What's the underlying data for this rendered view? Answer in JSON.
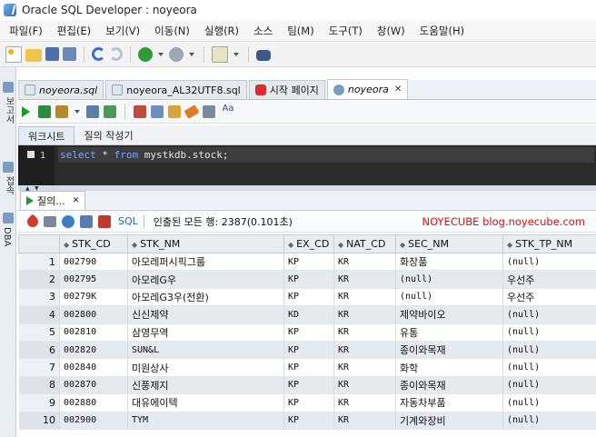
{
  "window": {
    "title": "Oracle SQL Developer : noyeora"
  },
  "menu": [
    "파일(F)",
    "편집(E)",
    "보기(V)",
    "이동(N)",
    "실행(R)",
    "소스",
    "팀(M)",
    "도구(T)",
    "창(W)",
    "도움말(H)"
  ],
  "left_dock": [
    "보고서",
    "접속",
    "DBA"
  ],
  "doc_tabs": [
    {
      "label": "noyeora.sql",
      "icon": "sql-file-icon",
      "active": false
    },
    {
      "label": "noyeora_AL32UTF8.sql",
      "icon": "sql-file-icon",
      "active": false
    },
    {
      "label": "시작 페이지",
      "icon": "oracle-icon",
      "active": false
    },
    {
      "label": "noyeora",
      "icon": "db-connection-icon",
      "active": true
    }
  ],
  "sub_tabs": [
    "워크시트",
    "질의 작성기"
  ],
  "editor": {
    "line_number": "1",
    "code": {
      "kw1": "select",
      "star": " * ",
      "kw2": "from",
      "rest": " mystkdb.stock;"
    }
  },
  "result": {
    "tab_label": "질의...",
    "sql_label": "SQL",
    "fetched_text": "인출된 모든 행: 2387(0.101초)",
    "watermark": "NOYECUBE blog.noyecube.com",
    "columns": [
      "STK_CD",
      "STK_NM",
      "EX_CD",
      "NAT_CD",
      "SEC_NM",
      "STK_TP_NM"
    ],
    "rows": [
      [
        "1",
        "002790",
        "아모레퍼시픽그룹",
        "KP",
        "KR",
        "화장품",
        "(null)"
      ],
      [
        "2",
        "002795",
        "아모레G우",
        "KP",
        "KR",
        "(null)",
        "우선주"
      ],
      [
        "3",
        "00279K",
        "아모레G3우(전환)",
        "KP",
        "KR",
        "(null)",
        "우선주"
      ],
      [
        "4",
        "002800",
        "신신제약",
        "KD",
        "KR",
        "제약바이오",
        "(null)"
      ],
      [
        "5",
        "002810",
        "삼영무역",
        "KP",
        "KR",
        "유통",
        "(null)"
      ],
      [
        "6",
        "002820",
        "SUN&L",
        "KP",
        "KR",
        "종이와목재",
        "(null)"
      ],
      [
        "7",
        "002840",
        "미원상사",
        "KP",
        "KR",
        "화학",
        "(null)"
      ],
      [
        "8",
        "002870",
        "신풍제지",
        "KP",
        "KR",
        "종이와목재",
        "(null)"
      ],
      [
        "9",
        "002880",
        "대유에이텍",
        "KP",
        "KR",
        "자동차부품",
        "(null)"
      ],
      [
        "10",
        "002900",
        "TYM",
        "KP",
        "KR",
        "기계와장비",
        "(null)"
      ]
    ]
  },
  "colors": {
    "run_green": "#1a9a2a",
    "editor_bg": "#2b2b2b",
    "keyword_blue": "#7ba7ff",
    "watermark_red": "#dd1111"
  }
}
